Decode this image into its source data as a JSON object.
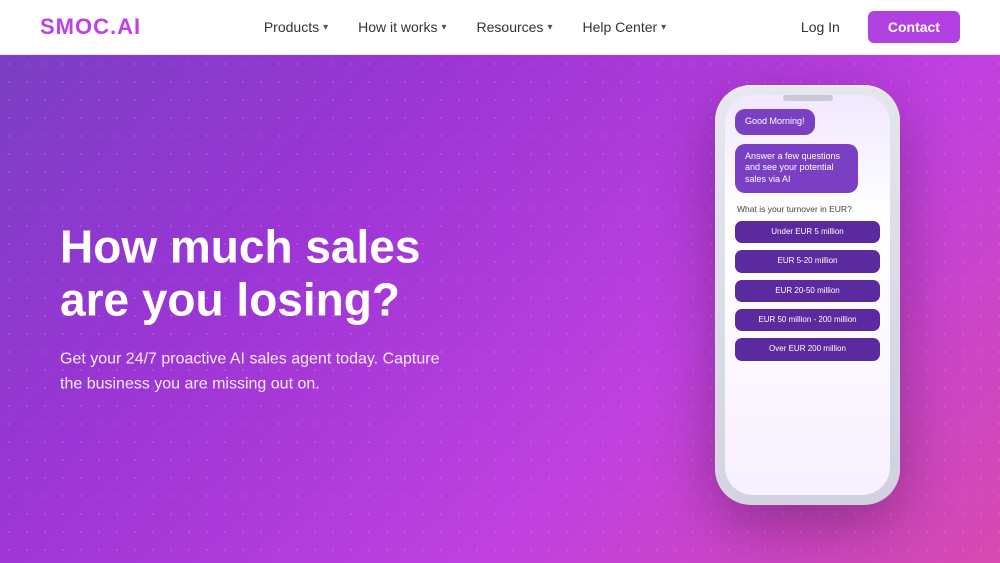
{
  "navbar": {
    "logo": "SMOC.AI",
    "links": [
      {
        "label": "Products",
        "hasDropdown": true
      },
      {
        "label": "How it works",
        "hasDropdown": true
      },
      {
        "label": "Resources",
        "hasDropdown": true
      },
      {
        "label": "Help Center",
        "hasDropdown": true
      }
    ],
    "login_label": "Log In",
    "contact_label": "Contact"
  },
  "hero": {
    "title": "How much sales are you losing?",
    "subtitle": "Get your 24/7 proactive AI sales agent today. Capture the business you are missing out on."
  },
  "phone": {
    "greeting": "Good Morning!",
    "intro": "Answer a few questions and see your potential sales via AI",
    "question": "What is your turnover in EUR?",
    "options": [
      "Under EUR 5 million",
      "EUR 5-20 million",
      "EUR 20-50 million",
      "EUR 50 million - 200 million",
      "Over EUR 200 million"
    ]
  }
}
